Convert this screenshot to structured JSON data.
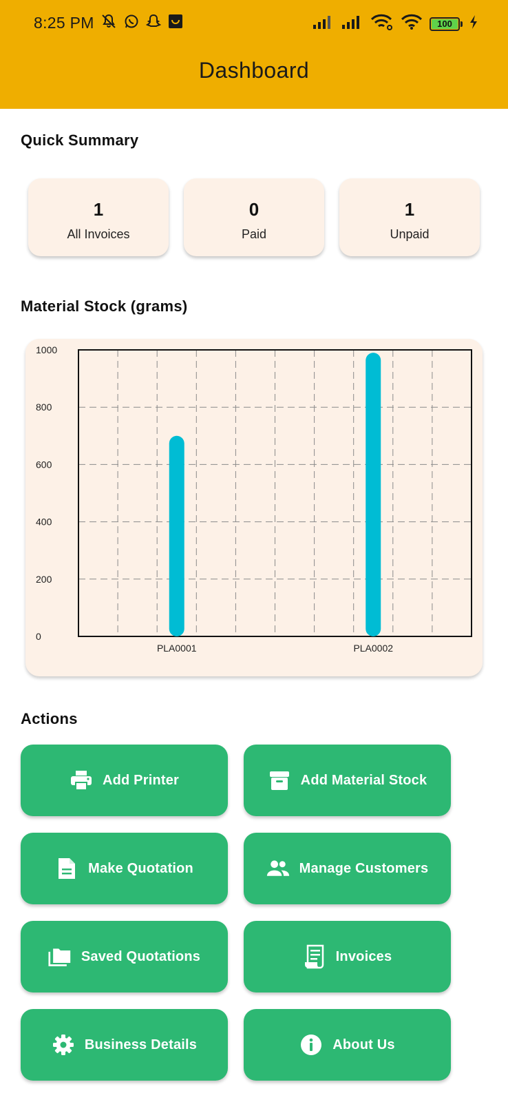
{
  "status_bar": {
    "time": "8:25 PM",
    "battery": "100",
    "left_icons": [
      "muted-bell-icon",
      "whatsapp-icon",
      "snapchat-icon",
      "shop-icon"
    ],
    "right_icons": [
      "signal-icon",
      "signal-icon",
      "wifi-link-icon",
      "wifi-icon",
      "battery-icon",
      "charging-icon"
    ]
  },
  "header": {
    "title": "Dashboard",
    "color": "#EFAE00"
  },
  "quick_summary": {
    "title": "Quick Summary",
    "cards": [
      {
        "value": "1",
        "label": "All Invoices"
      },
      {
        "value": "0",
        "label": "Paid"
      },
      {
        "value": "1",
        "label": "Unpaid"
      }
    ]
  },
  "material_stock": {
    "title": "Material Stock (grams)"
  },
  "chart_data": {
    "type": "bar",
    "categories": [
      "PLA0001",
      "PLA0002"
    ],
    "values": [
      700,
      990
    ],
    "title": "Material Stock (grams)",
    "xlabel": "",
    "ylabel": "",
    "ylim": [
      0,
      1000
    ],
    "yticks": [
      "0",
      "200",
      "400",
      "600",
      "800",
      "1000"
    ],
    "grid": true,
    "bar_color": "#00BCD4"
  },
  "actions": {
    "title": "Actions",
    "color": "#2DB873",
    "buttons": [
      {
        "label": "Add Printer",
        "icon": "printer-icon"
      },
      {
        "label": "Add Material Stock",
        "icon": "archive-box-icon"
      },
      {
        "label": "Make Quotation",
        "icon": "document-icon"
      },
      {
        "label": "Manage Customers",
        "icon": "people-icon"
      },
      {
        "label": "Saved Quotations",
        "icon": "folders-icon"
      },
      {
        "label": "Invoices",
        "icon": "receipt-icon"
      },
      {
        "label": "Business Details",
        "icon": "gear-icon"
      },
      {
        "label": "About Us",
        "icon": "info-icon"
      }
    ]
  }
}
